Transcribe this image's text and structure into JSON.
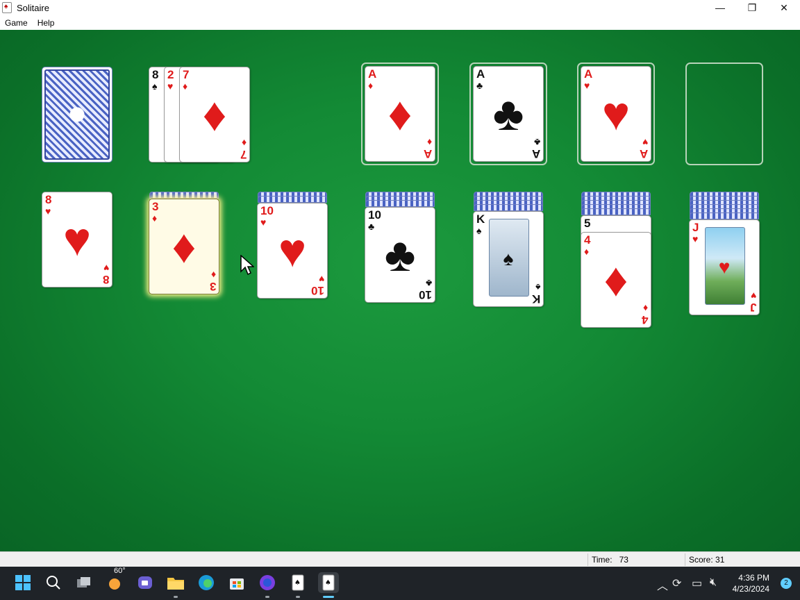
{
  "window": {
    "title": "Solitaire",
    "minimize": "—",
    "maximize": "❐",
    "close": "✕"
  },
  "menu": {
    "game": "Game",
    "help": "Help"
  },
  "stock": {
    "count_label": ""
  },
  "waste": [
    {
      "rank": "8",
      "suit": "♠",
      "color": "black"
    },
    {
      "rank": "2",
      "suit": "♥",
      "color": "red"
    },
    {
      "rank": "7",
      "suit": "♦",
      "color": "red"
    }
  ],
  "foundations": [
    {
      "rank": "A",
      "suit": "♦",
      "color": "red"
    },
    {
      "rank": "A",
      "suit": "♣",
      "color": "black"
    },
    {
      "rank": "A",
      "suit": "♥",
      "color": "red"
    },
    {
      "rank": "",
      "suit": "",
      "color": ""
    }
  ],
  "tableau": [
    {
      "hidden": 0,
      "cards": [
        {
          "rank": "8",
          "suit": "♥",
          "color": "red"
        }
      ]
    },
    {
      "hidden": 1,
      "cards": [
        {
          "rank": "3",
          "suit": "♦",
          "color": "red",
          "selected": true
        }
      ]
    },
    {
      "hidden": 2,
      "cards": [
        {
          "rank": "10",
          "suit": "♥",
          "color": "red"
        }
      ]
    },
    {
      "hidden": 3,
      "cards": [
        {
          "rank": "10",
          "suit": "♣",
          "color": "black"
        }
      ]
    },
    {
      "hidden": 4,
      "cards": [
        {
          "rank": "K",
          "suit": "♠",
          "color": "black"
        }
      ]
    },
    {
      "hidden": 5,
      "cards": [
        {
          "rank": "5",
          "suit": "♠",
          "color": "black"
        },
        {
          "rank": "4",
          "suit": "♦",
          "color": "red"
        }
      ]
    },
    {
      "hidden": 6,
      "cards": [
        {
          "rank": "J",
          "suit": "♥",
          "color": "red"
        }
      ]
    }
  ],
  "status": {
    "time_label": "Time:",
    "time_value": "73",
    "score_label": "Score:",
    "score_value": "31"
  },
  "taskbar": {
    "weather": "60°",
    "clock_time": "4:36 PM",
    "clock_date": "4/23/2024",
    "notifications": "2"
  },
  "colors": {
    "felt": "#138a35",
    "red_suit": "#e01b1b",
    "black_suit": "#111111",
    "accent": "#60cdff"
  }
}
